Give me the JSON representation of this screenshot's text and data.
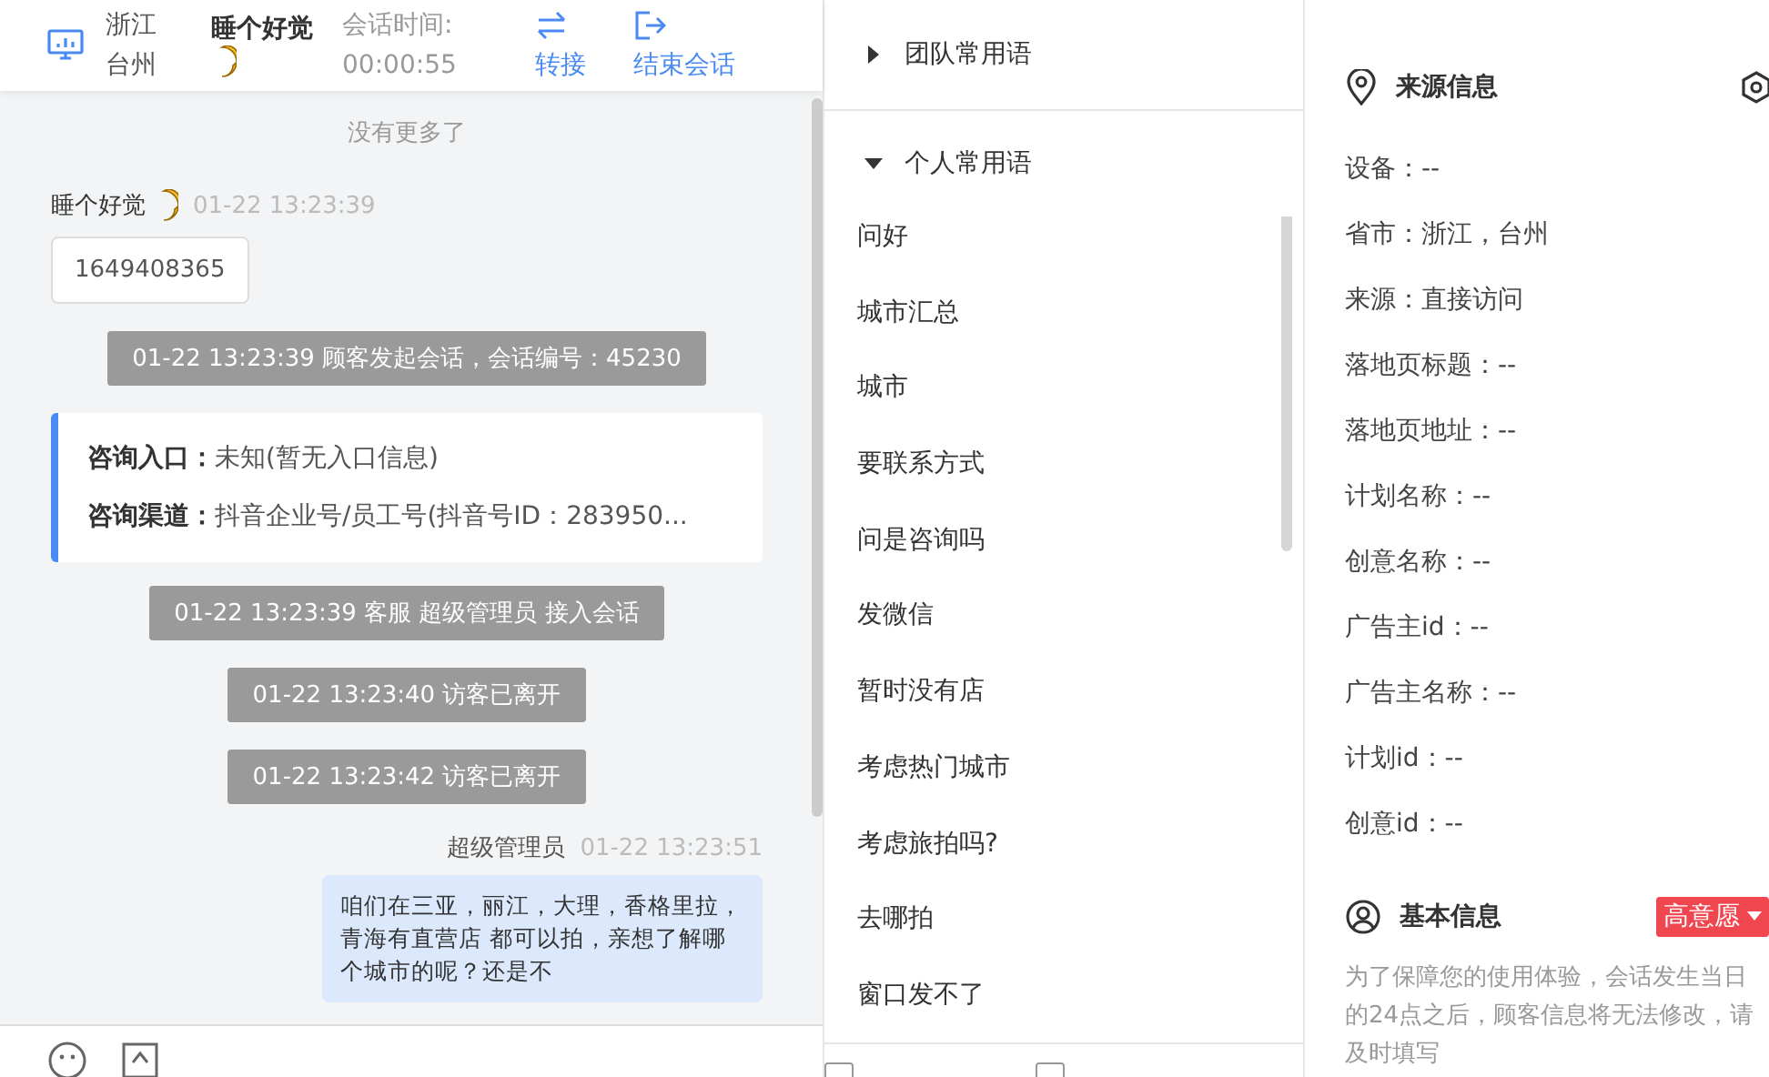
{
  "header": {
    "location": "浙江台州",
    "visitor": "睡个好觉",
    "timer_label": "会话时间:",
    "timer": "00:00:55",
    "actions": [
      {
        "kind": "transfer",
        "label": "转接"
      },
      {
        "kind": "end",
        "label": "结束会话"
      }
    ]
  },
  "chat": {
    "top_note": "没有更多了",
    "messages": [
      {
        "kind": "visitor",
        "sender": "睡个好觉",
        "time": "01-22 13:23:39",
        "text": "1649408365"
      },
      {
        "kind": "system",
        "text": "01-22 13:23:39 顾客发起会话，会话编号：45230"
      },
      {
        "kind": "info",
        "rows": [
          {
            "label": "咨询入口：",
            "value": "未知(暂无入口信息)"
          },
          {
            "label": "咨询渠道：",
            "value": "抖音企业号/员工号(抖音号ID：283950..."
          }
        ]
      },
      {
        "kind": "system",
        "text": "01-22 13:23:39 客服 超级管理员 接入会话"
      },
      {
        "kind": "system",
        "text": "01-22 13:23:40 访客已离开"
      },
      {
        "kind": "system",
        "text": "01-22 13:23:42 访客已离开"
      },
      {
        "kind": "agent",
        "sender": "超级管理员",
        "time": "01-22 13:23:51",
        "text": "咱们在三亚，丽江，大理，香格里拉，青海有直营店 都可以拍，亲想了解哪个城市的呢？还是不"
      }
    ]
  },
  "toolbar": {
    "checkboxes": [
      {
        "checked": false
      },
      {
        "checked": false
      }
    ]
  },
  "phrases": {
    "groups": [
      {
        "label": "团队常用语",
        "expanded": false
      },
      {
        "label": "个人常用语",
        "expanded": true,
        "items": [
          "问好",
          "城市汇总",
          "城市",
          "要联系方式",
          "问是咨询吗",
          "发微信",
          "暂时没有店",
          "考虑热门城市",
          "考虑旅拍吗?",
          "去哪拍",
          "窗口发不了"
        ]
      }
    ]
  },
  "source_info": {
    "title": "来源信息",
    "lines": [
      "设备：--",
      "省市：浙江，台州",
      "来源：直接访问",
      "落地页标题：--",
      "落地页地址：--",
      "计划名称：--",
      "创意名称：--",
      "广告主id：--",
      "广告主名称：--",
      "计划id：--",
      "创意id：--"
    ]
  },
  "basic_info": {
    "title": "基本信息",
    "intent": {
      "label": "高意愿",
      "color": "#f0464f"
    },
    "notice": "为了保障您的使用体验，会话发生当日的24点之后，顾客信息将无法修改，请及时填写"
  }
}
